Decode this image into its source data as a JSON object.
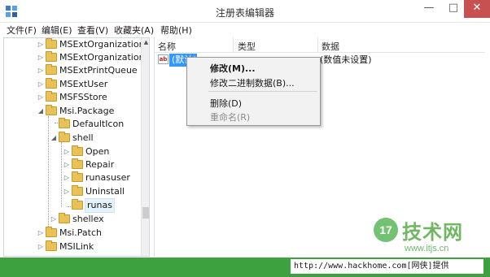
{
  "window": {
    "title": "注册表编辑器",
    "minimize": "—",
    "maximize": "□",
    "close": "✕"
  },
  "menu": [
    "文件(F)",
    "编辑(E)",
    "查看(V)",
    "收藏夹(A)",
    "帮助(H)"
  ],
  "tree": [
    {
      "label": "MSExtOrganization",
      "expand": "▷"
    },
    {
      "label": "MSExtOrganizationU",
      "expand": "▷"
    },
    {
      "label": "MSExtPrintQueue",
      "expand": "▷"
    },
    {
      "label": "MSExtUser",
      "expand": "▷"
    },
    {
      "label": "MSFSStore",
      "expand": "▷"
    },
    {
      "label": "Msi.Package",
      "expand": "◢"
    },
    {
      "label": "DefaultIcon",
      "expand": ""
    },
    {
      "label": "shell",
      "expand": "◢"
    },
    {
      "label": "Open",
      "expand": "▷"
    },
    {
      "label": "Repair",
      "expand": "▷"
    },
    {
      "label": "runasuser",
      "expand": "▷"
    },
    {
      "label": "Uninstall",
      "expand": "▷"
    },
    {
      "label": "runas",
      "expand": ""
    },
    {
      "label": "shellex",
      "expand": "▷"
    },
    {
      "label": "Msi.Patch",
      "expand": "▷"
    },
    {
      "label": "MSILink",
      "expand": "▷"
    }
  ],
  "list": {
    "columns": [
      "名称",
      "类型",
      "数据"
    ],
    "row": {
      "icon_text": "ab",
      "name": "(默认)",
      "data": "(数值未设置)"
    }
  },
  "context_menu": {
    "modify": "修改(M)...",
    "modify_binary": "修改二进制数据(B)...",
    "delete": "删除(D)",
    "rename": "重命名(R)"
  },
  "footer": {
    "url": "http://www.hackhome.com[网侠]提供",
    "color": "#3ea13f"
  },
  "watermark": {
    "badge": "17",
    "text": "技术网",
    "site": "www.itjs.cn"
  }
}
